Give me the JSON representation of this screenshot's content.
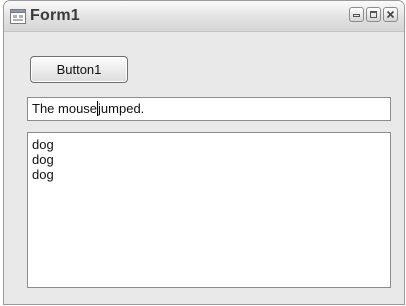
{
  "window": {
    "title": "Form1",
    "controls": [
      "minimize",
      "maximize",
      "close"
    ]
  },
  "button1": {
    "label": "Button1"
  },
  "textbox": {
    "text_before_caret": "The mouse",
    "text_after_caret": "jumped."
  },
  "listbox": {
    "items": [
      "dog",
      "dog",
      "dog"
    ]
  },
  "icons": {
    "app": "form-app-icon",
    "minimize": "minimize-icon",
    "maximize": "maximize-icon",
    "close": "close-icon"
  }
}
